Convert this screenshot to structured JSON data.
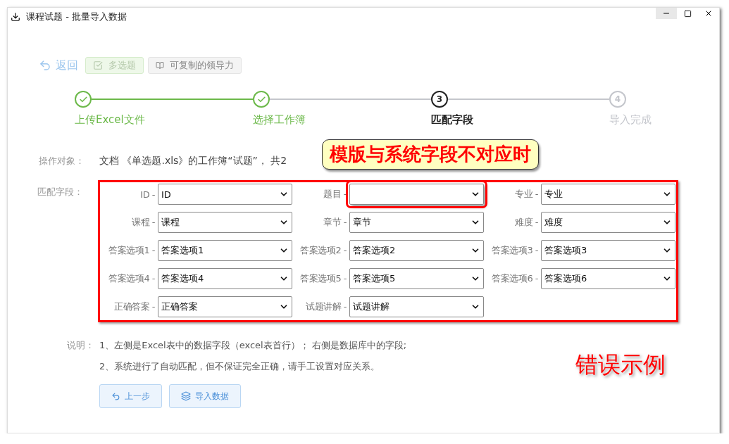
{
  "window": {
    "title": "课程试题 - 批量导入数据"
  },
  "toolbar": {
    "back": "返回",
    "buttons": [
      {
        "label": "多选题",
        "kind": "success"
      },
      {
        "label": "可复制的领导力",
        "kind": "plain"
      }
    ]
  },
  "steps": [
    {
      "label": "上传Excel文件",
      "completed": true,
      "selected": false
    },
    {
      "label": "选择工作簿",
      "completed": true,
      "selected": false
    },
    {
      "number": "3",
      "label": "匹配字段",
      "completed": false,
      "selected": true
    },
    {
      "number": "4",
      "label": "导入完成",
      "completed": false,
      "selected": false
    }
  ],
  "operation": {
    "label": "操作对象：",
    "text": "文档 《单选题.xls》的工作簿“试题”， 共2"
  },
  "callout": "模版与系统字段不对应时",
  "mapping": {
    "label": "匹配字段：",
    "highlighted": true,
    "fields": [
      {
        "label": "ID -",
        "value": "ID",
        "highlighted": false
      },
      {
        "label": "题目 -",
        "highlighted": true
      },
      {
        "label": "专业 -",
        "value": "专业",
        "highlighted": false
      },
      {
        "label": "课程 -",
        "value": "课程",
        "highlighted": false
      },
      {
        "label": "章节 -",
        "value": "章节",
        "highlighted": false
      },
      {
        "label": "难度 -",
        "value": "难度",
        "highlighted": false
      },
      {
        "label": "答案选项1 -",
        "value": "答案选项1",
        "highlighted": false
      },
      {
        "label": "答案选项2 -",
        "value": "答案选项2",
        "highlighted": false
      },
      {
        "label": "答案选项3 -",
        "value": "答案选项3",
        "highlighted": false
      },
      {
        "label": "答案选项4 -",
        "value": "答案选项4",
        "highlighted": false
      },
      {
        "label": "答案选项5 -",
        "value": "答案选项5",
        "highlighted": false
      },
      {
        "label": "答案选项6 -",
        "value": "答案选项6",
        "highlighted": false
      },
      {
        "label": "正确答案 -",
        "value": "正确答案",
        "highlighted": false
      },
      {
        "label": "试题讲解 -",
        "value": "试题讲解",
        "highlighted": false
      }
    ]
  },
  "notes": {
    "label": "说明：",
    "lines": [
      "1、左侧是Excel表中的数据字段（excel表首行）； 右侧是数据库中的字段;",
      "2、系统进行了自动匹配，但不保证完全正确，请手工设置对应关系。"
    ]
  },
  "actions": [
    {
      "label": "上一步",
      "kind": "back"
    },
    {
      "label": "导入数据",
      "kind": "import"
    }
  ],
  "stamp": "错误示例"
}
